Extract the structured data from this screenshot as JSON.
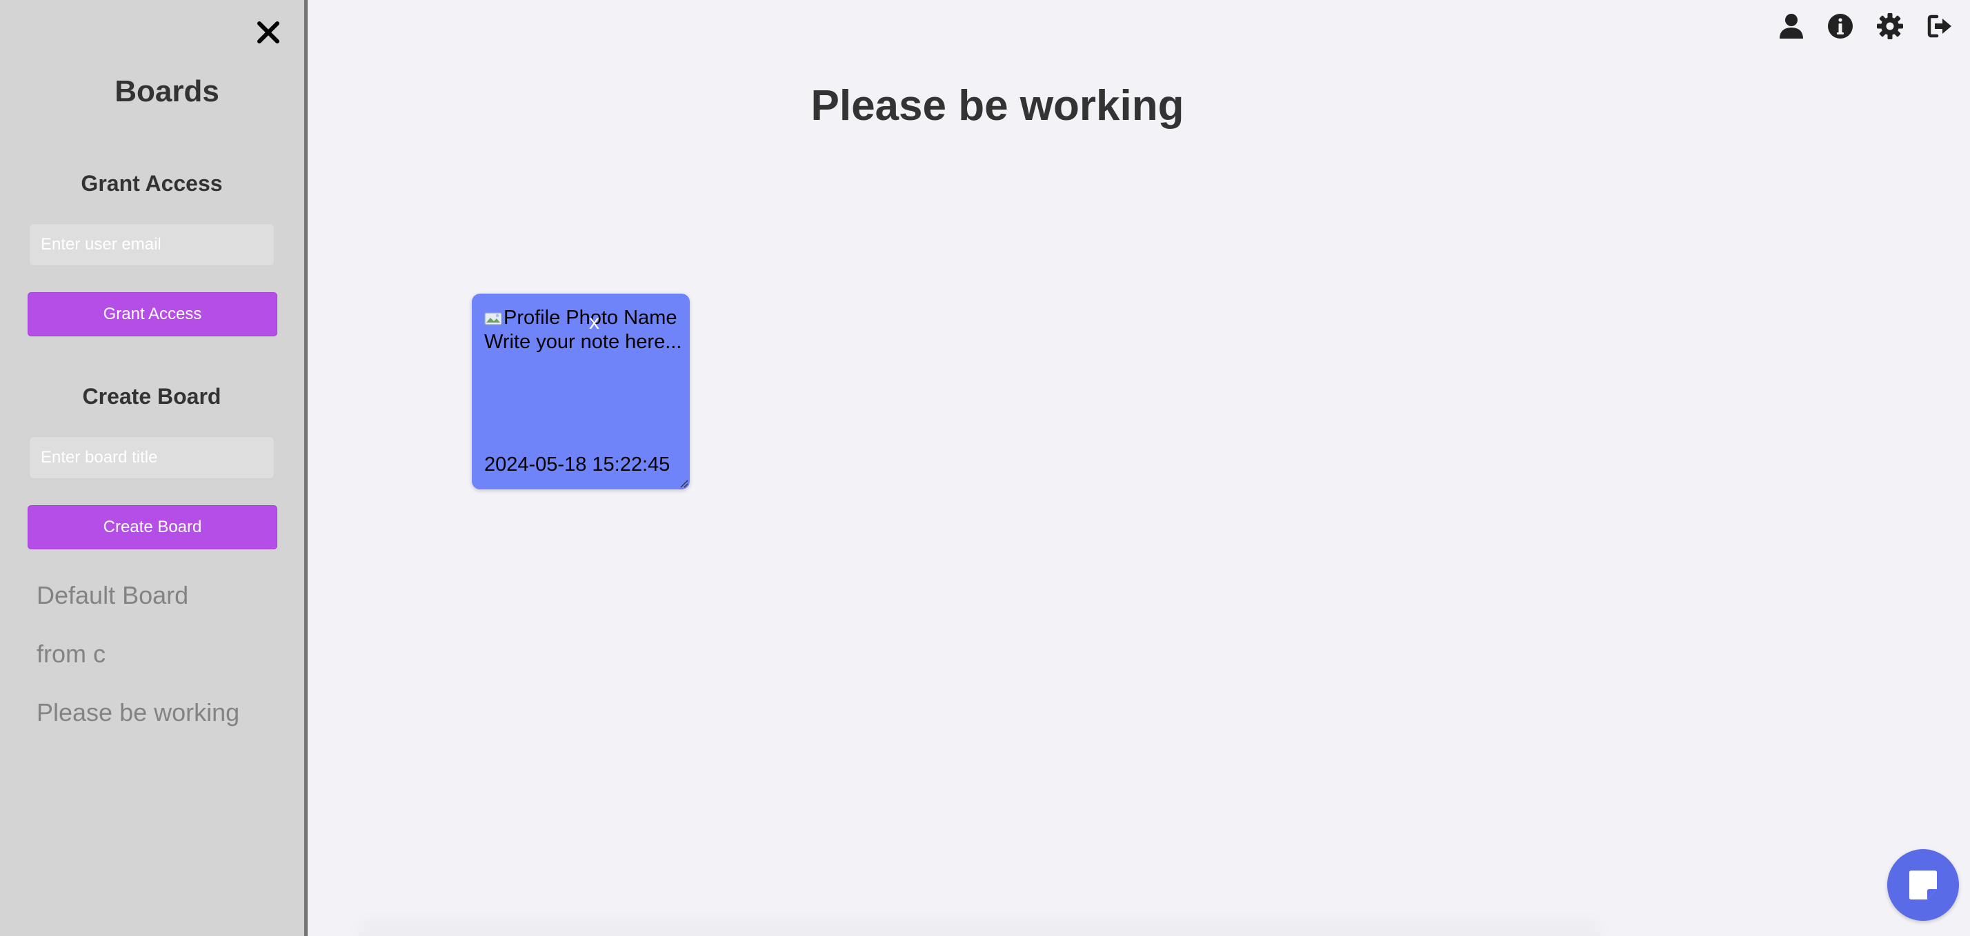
{
  "sidebar": {
    "title": "Boards",
    "grant_access": {
      "heading": "Grant Access",
      "email_placeholder": "Enter user email",
      "button_label": "Grant Access"
    },
    "create_board": {
      "heading": "Create Board",
      "title_placeholder": "Enter board title",
      "button_label": "Create Board"
    },
    "boards": [
      "Default Board",
      "from c",
      "Please be working"
    ]
  },
  "header_icons": [
    "user-icon",
    "info-icon",
    "gear-icon",
    "sign-out-icon"
  ],
  "main": {
    "board_title": "Please be working",
    "note": {
      "photo_alt": "Profile Photo",
      "name": "Name",
      "close_label": "x",
      "content_placeholder": "Write your note here...",
      "timestamp": "2024-05-18 15:22:45",
      "color": "#6f84f8"
    }
  },
  "colors": {
    "accent": "#b54ee6",
    "fab": "#5a6be8",
    "sidebar_bg": "#d4d4d4",
    "page_bg": "#f3f2f7"
  }
}
